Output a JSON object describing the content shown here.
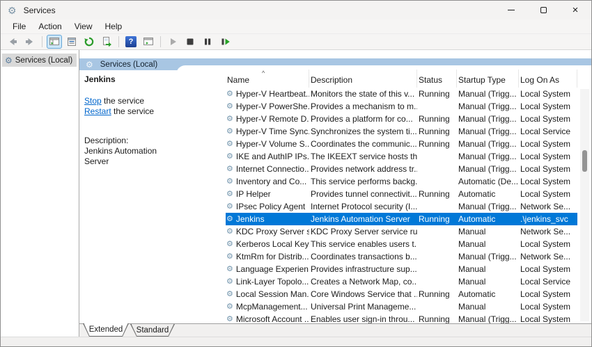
{
  "window": {
    "title": "Services",
    "controls": {
      "minimize": "minimize",
      "maximize": "maximize",
      "close": "close"
    }
  },
  "menu": {
    "items": [
      "File",
      "Action",
      "View",
      "Help"
    ]
  },
  "toolbar": {
    "icons": [
      "back",
      "forward",
      "show-console-tree",
      "properties",
      "refresh",
      "export-list",
      "help",
      "show-action-pane",
      "start-service",
      "stop-service",
      "pause-service",
      "restart-service"
    ],
    "selected_icon": "show-console-tree"
  },
  "tree": {
    "root_label": "Services (Local)"
  },
  "taskpane": {
    "header": "Services (Local)",
    "service_name": "Jenkins",
    "stop_link": "Stop",
    "stop_rest": " the service",
    "restart_link": "Restart",
    "restart_rest": " the service",
    "description_label": "Description:",
    "description_text": "Jenkins Automation Server"
  },
  "table": {
    "columns": [
      "Name",
      "Description",
      "Status",
      "Startup Type",
      "Log On As"
    ],
    "sort_column": "Name",
    "sort_indicator": "^",
    "rows": [
      {
        "name": "Hyper-V Heartbeat...",
        "description": "Monitors the state of this v...",
        "status": "Running",
        "startup": "Manual (Trigg...",
        "logon": "Local System",
        "selected": false
      },
      {
        "name": "Hyper-V PowerShe...",
        "description": "Provides a mechanism to m...",
        "status": "",
        "startup": "Manual (Trigg...",
        "logon": "Local System",
        "selected": false
      },
      {
        "name": "Hyper-V Remote D...",
        "description": "Provides a platform for co...",
        "status": "Running",
        "startup": "Manual (Trigg...",
        "logon": "Local System",
        "selected": false
      },
      {
        "name": "Hyper-V Time Sync...",
        "description": "Synchronizes the system ti...",
        "status": "Running",
        "startup": "Manual (Trigg...",
        "logon": "Local Service",
        "selected": false
      },
      {
        "name": "Hyper-V Volume S...",
        "description": "Coordinates the communic...",
        "status": "Running",
        "startup": "Manual (Trigg...",
        "logon": "Local System",
        "selected": false
      },
      {
        "name": "IKE and AuthIP IPs...",
        "description": "The IKEEXT service hosts th...",
        "status": "",
        "startup": "Manual (Trigg...",
        "logon": "Local System",
        "selected": false
      },
      {
        "name": "Internet Connectio...",
        "description": "Provides network address tr...",
        "status": "",
        "startup": "Manual (Trigg...",
        "logon": "Local System",
        "selected": false
      },
      {
        "name": "Inventory and Co...",
        "description": "This service performs backg...",
        "status": "",
        "startup": "Automatic (De...",
        "logon": "Local System",
        "selected": false
      },
      {
        "name": "IP Helper",
        "description": "Provides tunnel connectivit...",
        "status": "Running",
        "startup": "Automatic",
        "logon": "Local System",
        "selected": false
      },
      {
        "name": "IPsec Policy Agent",
        "description": "Internet Protocol security (I...",
        "status": "",
        "startup": "Manual (Trigg...",
        "logon": "Network Se...",
        "selected": false
      },
      {
        "name": "Jenkins",
        "description": "Jenkins Automation Server",
        "status": "Running",
        "startup": "Automatic",
        "logon": ".\\jenkins_svc",
        "selected": true
      },
      {
        "name": "KDC Proxy Server s...",
        "description": "KDC Proxy Server service ru...",
        "status": "",
        "startup": "Manual",
        "logon": "Network Se...",
        "selected": false
      },
      {
        "name": "Kerberos Local Key...",
        "description": "This service enables users t...",
        "status": "",
        "startup": "Manual",
        "logon": "Local System",
        "selected": false
      },
      {
        "name": "KtmRm for Distrib...",
        "description": "Coordinates transactions b...",
        "status": "",
        "startup": "Manual (Trigg...",
        "logon": "Network Se...",
        "selected": false
      },
      {
        "name": "Language Experien...",
        "description": "Provides infrastructure sup...",
        "status": "",
        "startup": "Manual",
        "logon": "Local System",
        "selected": false
      },
      {
        "name": "Link-Layer Topolo...",
        "description": "Creates a Network Map, co...",
        "status": "",
        "startup": "Manual",
        "logon": "Local Service",
        "selected": false
      },
      {
        "name": "Local Session Man...",
        "description": "Core Windows Service that ...",
        "status": "Running",
        "startup": "Automatic",
        "logon": "Local System",
        "selected": false
      },
      {
        "name": "McpManagement...",
        "description": "Universal Print Manageme...",
        "status": "",
        "startup": "Manual",
        "logon": "Local System",
        "selected": false
      },
      {
        "name": "Microsoft Account ...",
        "description": "Enables user sign-in throu...",
        "status": "Running",
        "startup": "Manual (Trigg...",
        "logon": "Local System",
        "selected": false
      }
    ]
  },
  "tabs": {
    "items": [
      "Extended",
      "Standard"
    ],
    "active": "Extended"
  },
  "colors": {
    "accent": "#0078d7",
    "band": "#a8c6e3",
    "link": "#0066cc",
    "selection_text": "#ffffff"
  }
}
